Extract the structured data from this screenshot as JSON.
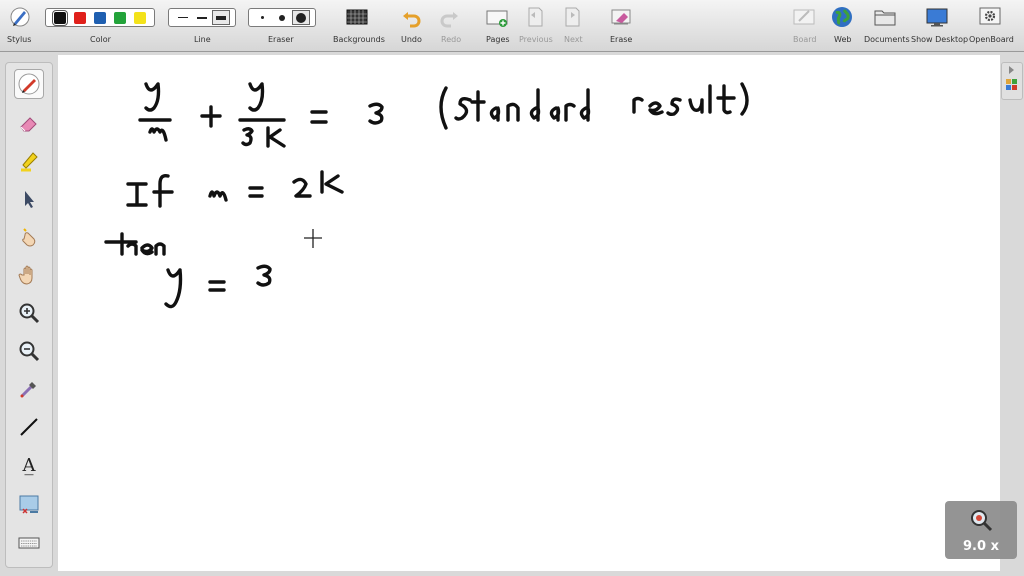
{
  "toolbar": {
    "stylus_label": "Stylus",
    "color_label": "Color",
    "line_label": "Line",
    "eraser_label": "Eraser",
    "backgrounds_label": "Backgrounds",
    "undo_label": "Undo",
    "redo_label": "Redo",
    "pages_label": "Pages",
    "previous_label": "Previous",
    "next_label": "Next",
    "erase_label": "Erase",
    "board_label": "Board",
    "web_label": "Web",
    "documents_label": "Documents",
    "show_desktop_label": "Show Desktop",
    "openboard_label": "OpenBoard",
    "colors": [
      "#111111",
      "#e0201b",
      "#1f5fb0",
      "#23a33a",
      "#f3e21a"
    ],
    "selected_color": "#111111"
  },
  "palette": {
    "text_tool_glyph": "A̲",
    "tools": [
      "pen-icon",
      "eraser-icon",
      "highlighter-icon",
      "pointer-icon",
      "laser-hand-icon",
      "pan-hand-icon",
      "zoom-in-icon",
      "zoom-out-icon",
      "pipette-icon",
      "line-icon",
      "text-icon",
      "capture-icon",
      "keyboard-icon"
    ]
  },
  "zoom": {
    "level_text": "9.0 x"
  },
  "board": {
    "ink_color": "#111111",
    "background": "#ffffff"
  }
}
